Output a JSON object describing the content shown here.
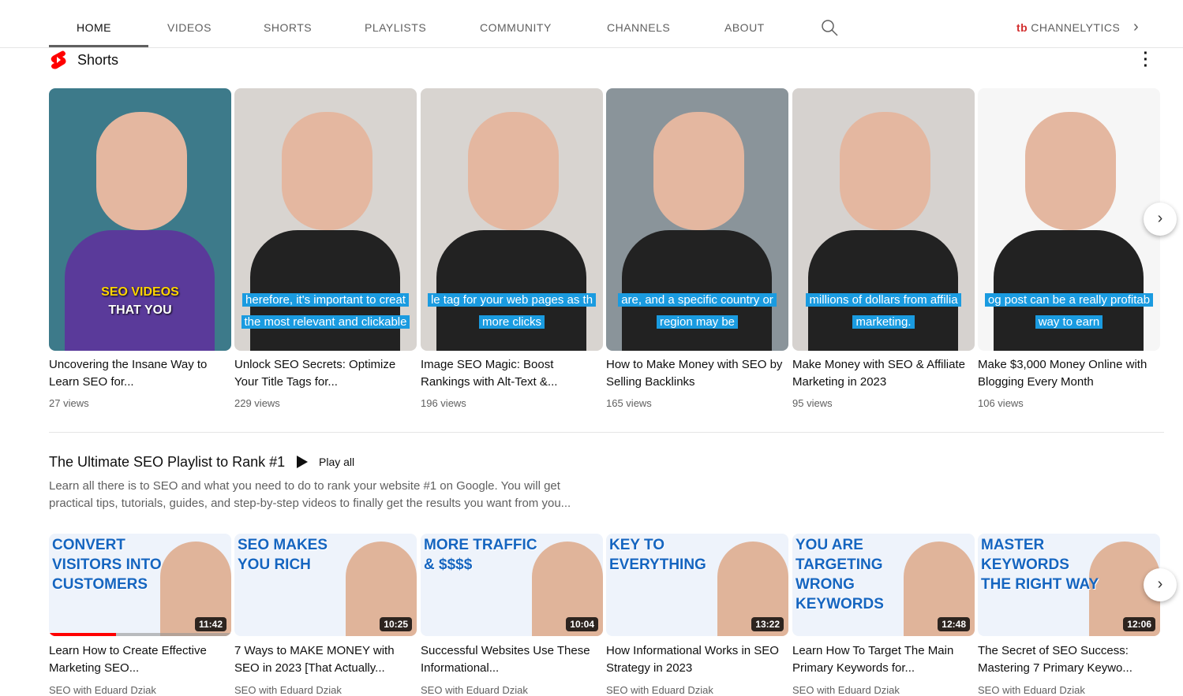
{
  "nav": {
    "tabs": [
      "HOME",
      "VIDEOS",
      "SHORTS",
      "PLAYLISTS",
      "COMMUNITY",
      "CHANNELS",
      "ABOUT"
    ],
    "active": "HOME",
    "extension_logo": "tb",
    "extension_label": "CHANNELYTICS",
    "next": "›"
  },
  "shorts": {
    "title": "Shorts",
    "more": "⋮",
    "items": [
      {
        "title": "Uncovering the Insane Way to Learn SEO for...",
        "views": "27 views",
        "caption1": "SEO VIDEOS",
        "caption2": "THAT YOU",
        "bg": "#3d7a8a"
      },
      {
        "title": "Unlock SEO Secrets: Optimize Your Title Tags for...",
        "views": "229 views",
        "caption1": "herefore, it's important to creat",
        "caption2": "the most relevant and clickable",
        "bg": "#d8d4d0"
      },
      {
        "title": "Image SEO Magic: Boost Rankings with Alt-Text &...",
        "views": "196 views",
        "caption1": "le tag for your web pages as th",
        "caption2": "more clicks",
        "bg": "#d8d4d0"
      },
      {
        "title": "How to Make Money with SEO by Selling Backlinks",
        "views": "165 views",
        "caption1": "are, and a specific country or",
        "caption2": "region may be",
        "bg": "#8a949a"
      },
      {
        "title": "Make Money with SEO & Affiliate Marketing in 2023",
        "views": "95 views",
        "caption1": "millions of dollars from affilia",
        "caption2": "marketing.",
        "bg": "#d6d2cf"
      },
      {
        "title": "Make $3,000 Money Online with Blogging Every Month",
        "views": "106 views",
        "caption1": "og post can be a really profitab",
        "caption2": "way to earn",
        "bg": "#f6f6f6"
      }
    ]
  },
  "playlist": {
    "title": "The Ultimate SEO Playlist to Rank #1",
    "play_all": "Play all",
    "description": "Learn all there is to SEO and what you need to do to rank your website #1 on Google. You will get practical tips, tutorials, guides, and step-by-step videos to finally get the results you want from you...",
    "videos": [
      {
        "thumb_text": "CONVERT VISITORS INTO CUSTOMERS",
        "duration": "11:42",
        "title": "Learn How to Create Effective Marketing SEO...",
        "channel": "SEO with Eduard Dziak",
        "progress": 0.37
      },
      {
        "thumb_text": "SEO MAKES YOU RICH",
        "duration": "10:25",
        "title": "7 Ways to MAKE MONEY with SEO in 2023 [That Actually...",
        "channel": "SEO with Eduard Dziak"
      },
      {
        "thumb_text": "MORE TRAFFIC & $$$$",
        "duration": "10:04",
        "title": "Successful Websites Use These Informational...",
        "channel": "SEO with Eduard Dziak"
      },
      {
        "thumb_text": "KEY TO EVERYTHING",
        "duration": "13:22",
        "title": "How Informational Works in SEO Strategy in 2023",
        "channel": "SEO with Eduard Dziak"
      },
      {
        "thumb_text": "YOU ARE TARGETING WRONG KEYWORDS",
        "duration": "12:48",
        "title": "Learn How To Target The Main Primary Keywords for...",
        "channel": "SEO with Eduard Dziak"
      },
      {
        "thumb_text": "MASTER KEYWORDS THE RIGHT WAY",
        "duration": "12:06",
        "title": "The Secret of SEO Success: Mastering 7 Primary Keywo...",
        "channel": "SEO with Eduard Dziak"
      }
    ]
  },
  "colors": {
    "accent": "#ff0000",
    "caption_bg": "#1a9be0"
  }
}
